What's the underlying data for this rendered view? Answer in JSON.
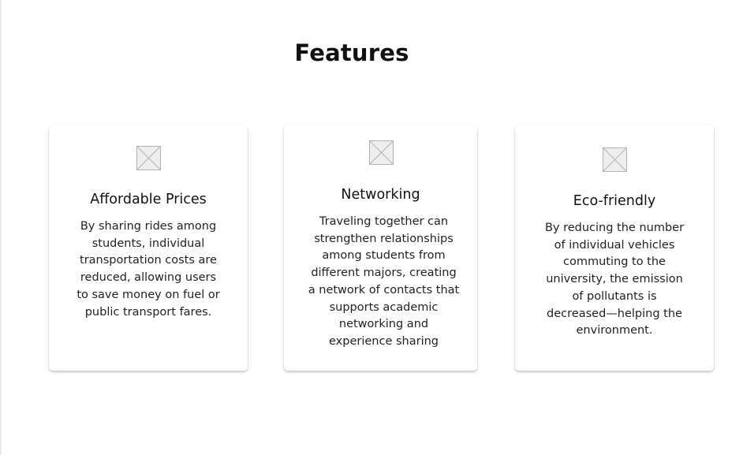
{
  "section": {
    "title": "Features"
  },
  "features": [
    {
      "title": "Affordable Prices",
      "icon": "image-placeholder-icon",
      "description": "By sharing rides among students, individual transportation costs are reduced, allowing users to save money on fuel or public transport fares."
    },
    {
      "title": "Networking",
      "icon": "image-placeholder-icon",
      "description": "Traveling together can strengthen relationships among students from different majors, creating a network of contacts that supports academic networking and experience sharing"
    },
    {
      "title": "Eco-friendly",
      "icon": "image-placeholder-icon",
      "description": "By reducing the number of individual vehicles commuting to the university, the emission of pollutants is decreased—helping the environment."
    }
  ],
  "colors": {
    "background": "#ffffff",
    "text": "#111111",
    "placeholder_fill": "#eeeeee",
    "placeholder_stroke": "#b3b3b3"
  }
}
